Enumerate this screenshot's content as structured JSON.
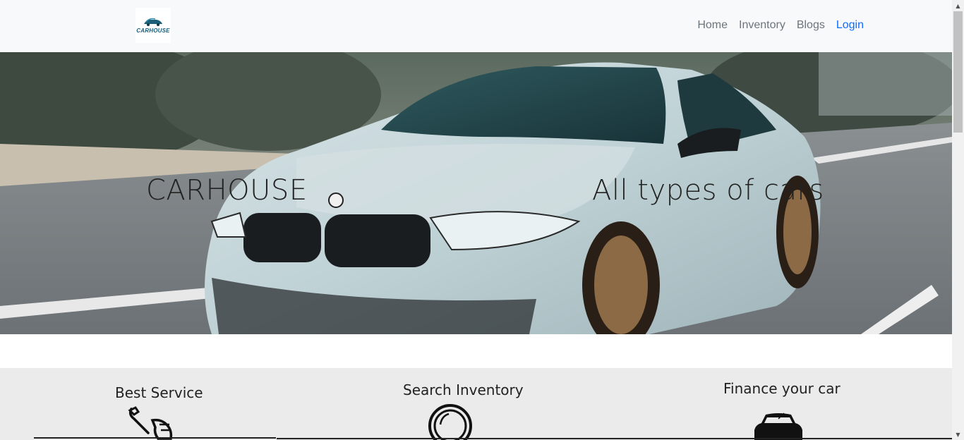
{
  "navbar": {
    "logo_text": "CARHOUSE",
    "links": [
      "Home",
      "Inventory",
      "Blogs",
      "Login"
    ]
  },
  "hero": {
    "title": "CARHOUSE",
    "subtitle": "All types of cars"
  },
  "features": [
    {
      "title": "Best Service",
      "icon": "wrench-hand-icon"
    },
    {
      "title": "Search Inventory",
      "icon": "search-circle-icon"
    },
    {
      "title": "Finance your car",
      "icon": "car-icon"
    }
  ]
}
